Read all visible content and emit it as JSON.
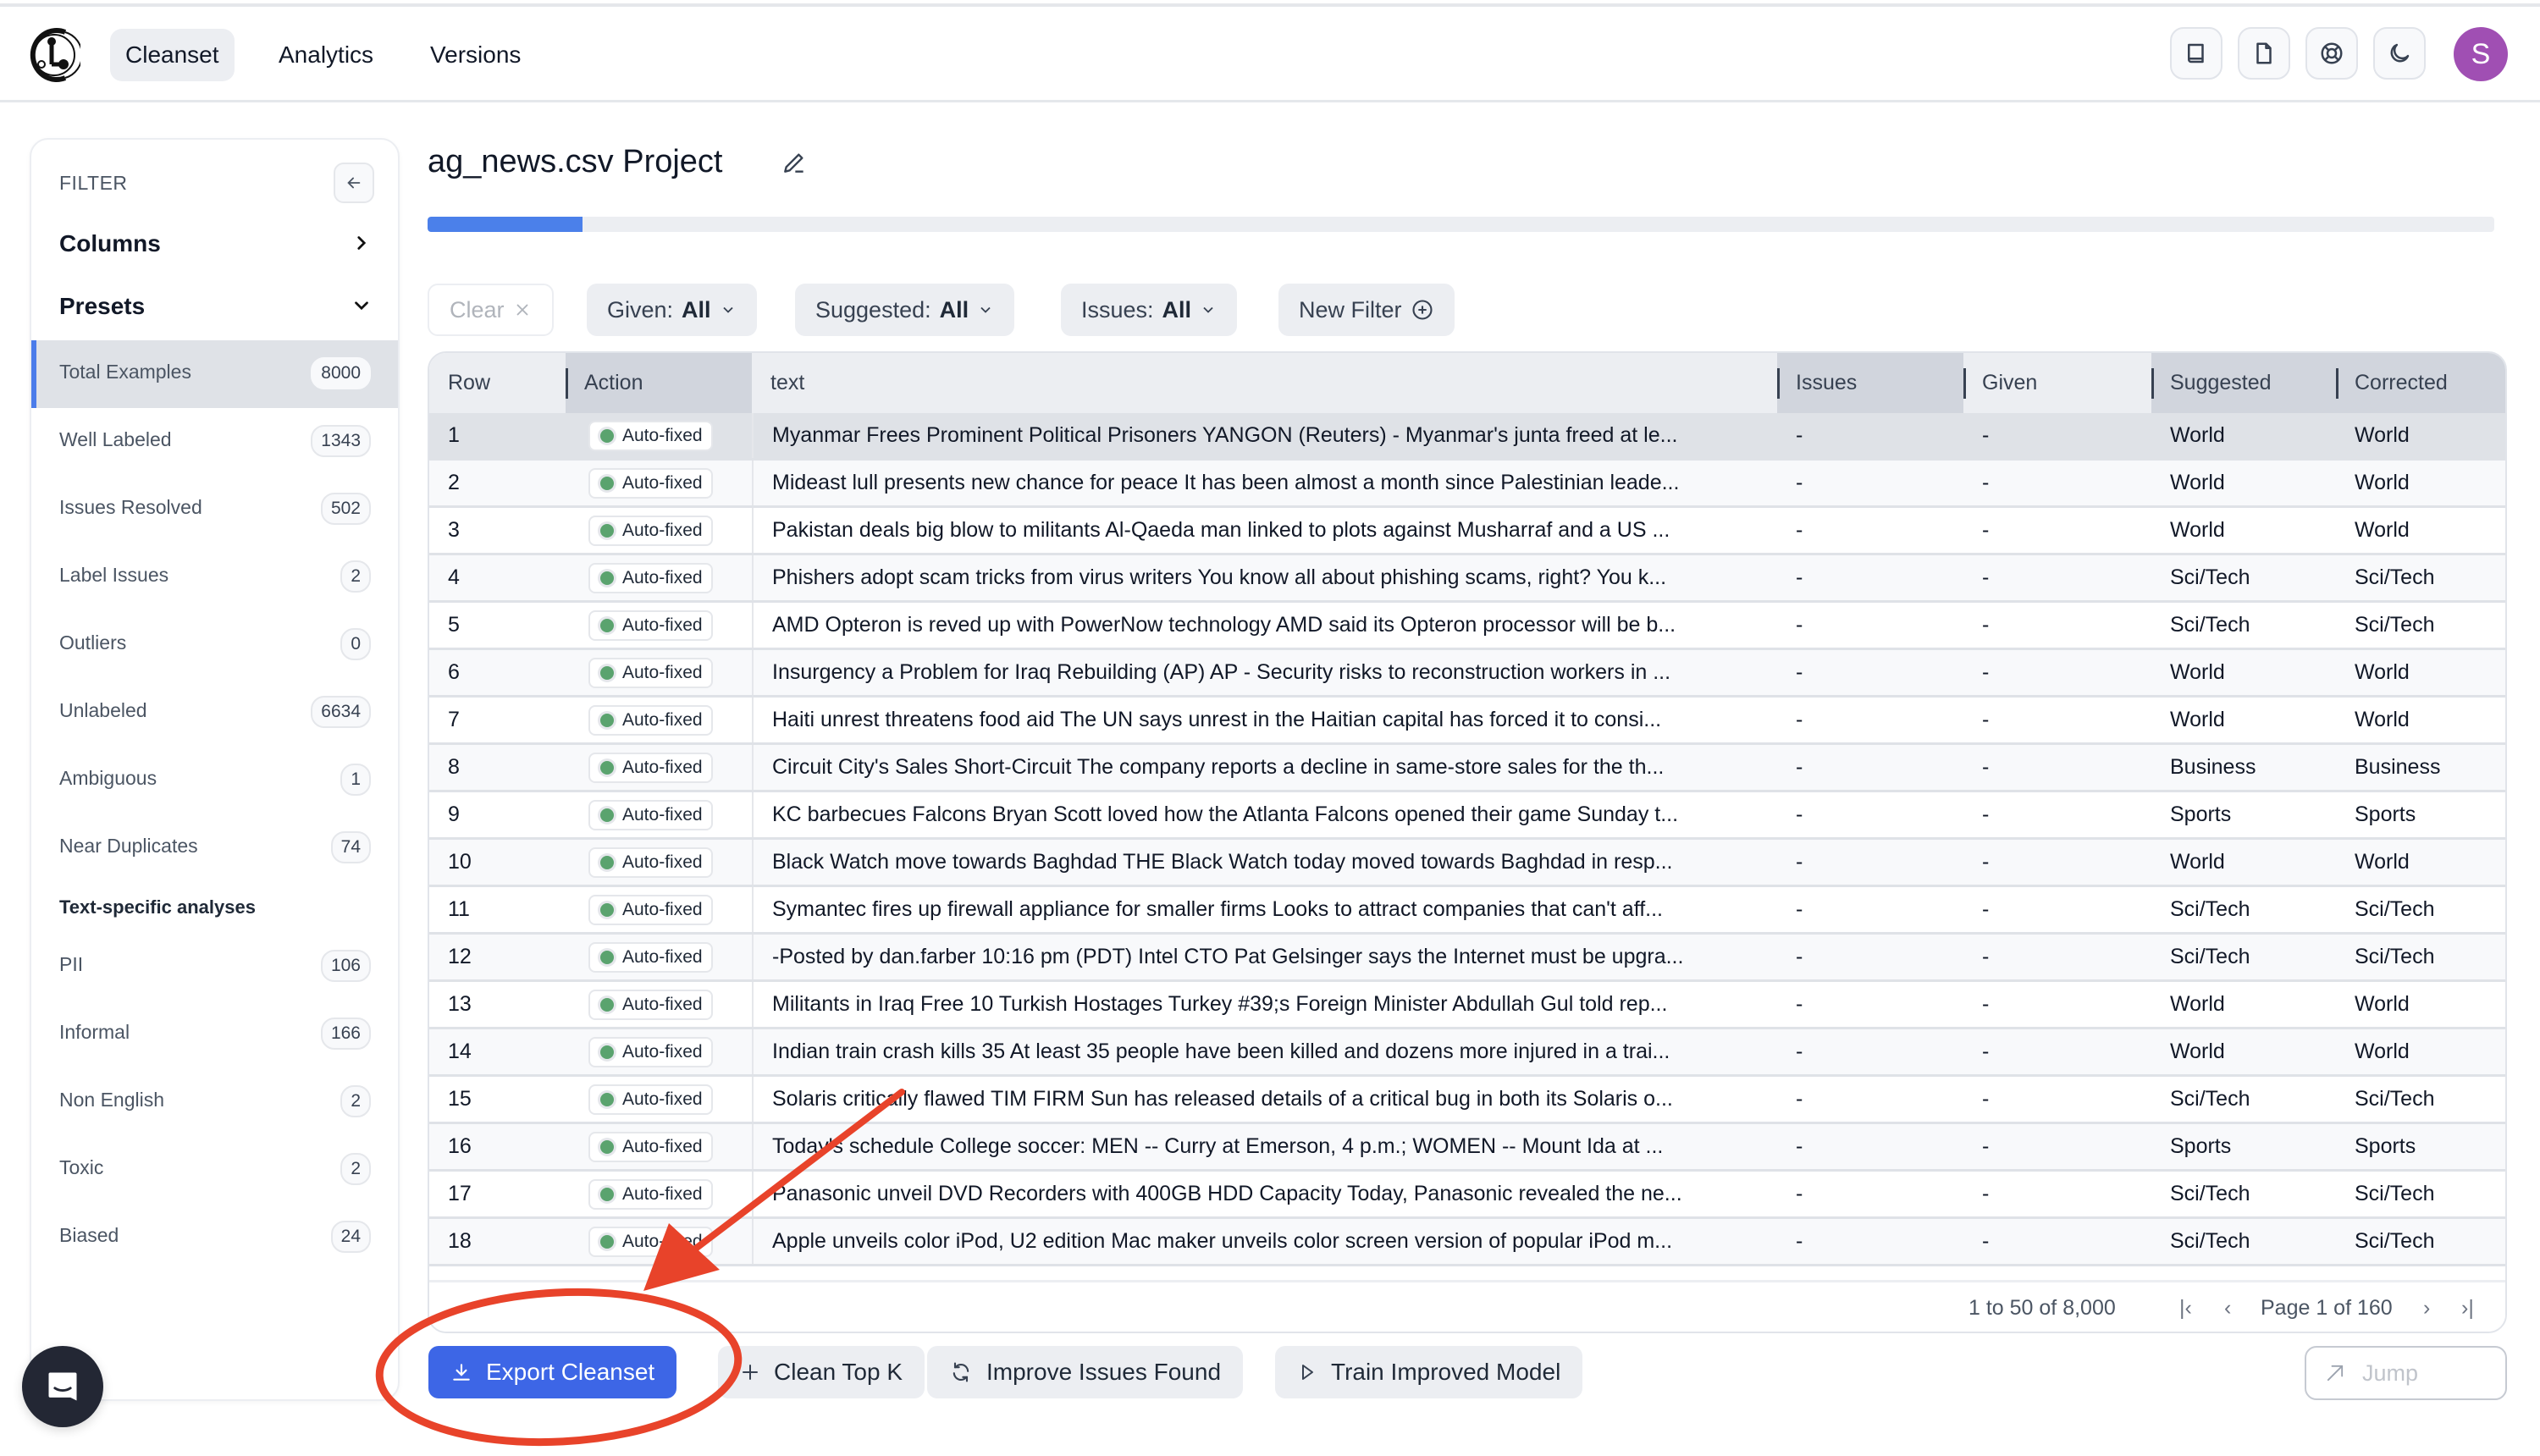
{
  "header": {
    "logo": "cleanlab-logo",
    "tabs": [
      {
        "label": "Cleanset",
        "active": true
      },
      {
        "label": "Analytics",
        "active": false
      },
      {
        "label": "Versions",
        "active": false
      }
    ],
    "icon_buttons": [
      "book-icon",
      "document-icon",
      "lifebuoy-icon",
      "moon-icon"
    ],
    "avatar_initial": "S",
    "avatar_color": "#a04fb3"
  },
  "sidebar": {
    "title": "FILTER",
    "columns_label": "Columns",
    "presets_label": "Presets",
    "presets": [
      {
        "label": "Total Examples",
        "count": "8000",
        "active": true
      },
      {
        "label": "Well Labeled",
        "count": "1343"
      },
      {
        "label": "Issues Resolved",
        "count": "502"
      },
      {
        "label": "Label Issues",
        "count": "2"
      },
      {
        "label": "Outliers",
        "count": "0"
      },
      {
        "label": "Unlabeled",
        "count": "6634"
      },
      {
        "label": "Ambiguous",
        "count": "1"
      },
      {
        "label": "Near Duplicates",
        "count": "74"
      }
    ],
    "text_section_label": "Text-specific analyses",
    "text_presets": [
      {
        "label": "PII",
        "count": "106"
      },
      {
        "label": "Informal",
        "count": "166"
      },
      {
        "label": "Non English",
        "count": "2"
      },
      {
        "label": "Toxic",
        "count": "2"
      },
      {
        "label": "Biased",
        "count": "24"
      }
    ]
  },
  "main": {
    "title": "ag_news.csv Project",
    "progress_fraction": 0.075,
    "accent_color": "#4b80ea",
    "filters": {
      "clear_label": "Clear",
      "given_label": "Given:",
      "given_value": "All",
      "suggested_label": "Suggested:",
      "suggested_value": "All",
      "issues_label": "Issues:",
      "issues_value": "All",
      "new_filter_label": "New Filter"
    },
    "table": {
      "columns": [
        "Row",
        "Action",
        "text",
        "Issues",
        "Given",
        "Suggested",
        "Corrected"
      ],
      "rows": [
        {
          "row": "1",
          "action": "Auto-fixed",
          "text": "Myanmar Frees Prominent Political Prisoners YANGON (Reuters) - Myanmar's junta freed at le...",
          "issues": "-",
          "given": "-",
          "suggested": "World",
          "corrected": "World"
        },
        {
          "row": "2",
          "action": "Auto-fixed",
          "text": "Mideast lull presents new chance for peace It has been almost a month since Palestinian leade...",
          "issues": "-",
          "given": "-",
          "suggested": "World",
          "corrected": "World"
        },
        {
          "row": "3",
          "action": "Auto-fixed",
          "text": "Pakistan deals big blow to militants Al-Qaeda man linked to plots against Musharraf and a US ...",
          "issues": "-",
          "given": "-",
          "suggested": "World",
          "corrected": "World"
        },
        {
          "row": "4",
          "action": "Auto-fixed",
          "text": "Phishers adopt scam tricks from virus writers You know all about phishing scams, right? You k...",
          "issues": "-",
          "given": "-",
          "suggested": "Sci/Tech",
          "corrected": "Sci/Tech"
        },
        {
          "row": "5",
          "action": "Auto-fixed",
          "text": "AMD Opteron is reved up with PowerNow technology AMD said its Opteron processor will be b...",
          "issues": "-",
          "given": "-",
          "suggested": "Sci/Tech",
          "corrected": "Sci/Tech"
        },
        {
          "row": "6",
          "action": "Auto-fixed",
          "text": "Insurgency a Problem for Iraq Rebuilding (AP) AP - Security risks to reconstruction workers in ...",
          "issues": "-",
          "given": "-",
          "suggested": "World",
          "corrected": "World"
        },
        {
          "row": "7",
          "action": "Auto-fixed",
          "text": "Haiti unrest threatens food aid The UN says unrest in the Haitian capital has forced it to consi...",
          "issues": "-",
          "given": "-",
          "suggested": "World",
          "corrected": "World"
        },
        {
          "row": "8",
          "action": "Auto-fixed",
          "text": "Circuit City's Sales Short-Circuit The company reports a decline in same-store sales for the th...",
          "issues": "-",
          "given": "-",
          "suggested": "Business",
          "corrected": "Business"
        },
        {
          "row": "9",
          "action": "Auto-fixed",
          "text": "KC barbecues Falcons Bryan Scott loved how the Atlanta Falcons opened their game Sunday t...",
          "issues": "-",
          "given": "-",
          "suggested": "Sports",
          "corrected": "Sports"
        },
        {
          "row": "10",
          "action": "Auto-fixed",
          "text": "Black Watch move towards Baghdad THE Black Watch today moved towards Baghdad in resp...",
          "issues": "-",
          "given": "-",
          "suggested": "World",
          "corrected": "World"
        },
        {
          "row": "11",
          "action": "Auto-fixed",
          "text": "Symantec fires up firewall appliance for smaller firms Looks to attract companies that can't aff...",
          "issues": "-",
          "given": "-",
          "suggested": "Sci/Tech",
          "corrected": "Sci/Tech"
        },
        {
          "row": "12",
          "action": "Auto-fixed",
          "text": "-Posted by dan.farber 10:16 pm (PDT) Intel CTO Pat Gelsinger says the Internet must be upgra...",
          "issues": "-",
          "given": "-",
          "suggested": "Sci/Tech",
          "corrected": "Sci/Tech"
        },
        {
          "row": "13",
          "action": "Auto-fixed",
          "text": "Militants in Iraq Free 10 Turkish Hostages Turkey #39;s Foreign Minister Abdullah Gul told rep...",
          "issues": "-",
          "given": "-",
          "suggested": "World",
          "corrected": "World"
        },
        {
          "row": "14",
          "action": "Auto-fixed",
          "text": "Indian train crash kills 35 At least 35 people have been killed and dozens more injured in a trai...",
          "issues": "-",
          "given": "-",
          "suggested": "World",
          "corrected": "World"
        },
        {
          "row": "15",
          "action": "Auto-fixed",
          "text": "Solaris critically flawed TIM FIRM Sun has released details of a critical bug in both its Solaris o...",
          "issues": "-",
          "given": "-",
          "suggested": "Sci/Tech",
          "corrected": "Sci/Tech"
        },
        {
          "row": "16",
          "action": "Auto-fixed",
          "text": "Today's schedule College soccer: MEN -- Curry at Emerson, 4 p.m.; WOMEN -- Mount Ida at ...",
          "issues": "-",
          "given": "-",
          "suggested": "Sports",
          "corrected": "Sports"
        },
        {
          "row": "17",
          "action": "Auto-fixed",
          "text": "Panasonic unveil DVD Recorders with 400GB HDD Capacity Today, Panasonic revealed the ne...",
          "issues": "-",
          "given": "-",
          "suggested": "Sci/Tech",
          "corrected": "Sci/Tech"
        },
        {
          "row": "18",
          "action": "Auto-fixed",
          "text": "Apple unveils color iPod, U2 edition Mac maker unveils color screen version of popular iPod m...",
          "issues": "-",
          "given": "-",
          "suggested": "Sci/Tech",
          "corrected": "Sci/Tech"
        }
      ],
      "action_status_color": "#5aa36e"
    },
    "pagination": {
      "range": "1 to 50 of 8,000",
      "page": "Page 1 of 160"
    },
    "actions": {
      "export_label": "Export Cleanset",
      "clean_topk_label": "Clean Top K",
      "improve_label": "Improve Issues Found",
      "train_label": "Train Improved Model",
      "jump_placeholder": "Jump"
    },
    "annotation": {
      "color": "#e8432a",
      "target": "Export Cleanset"
    }
  }
}
